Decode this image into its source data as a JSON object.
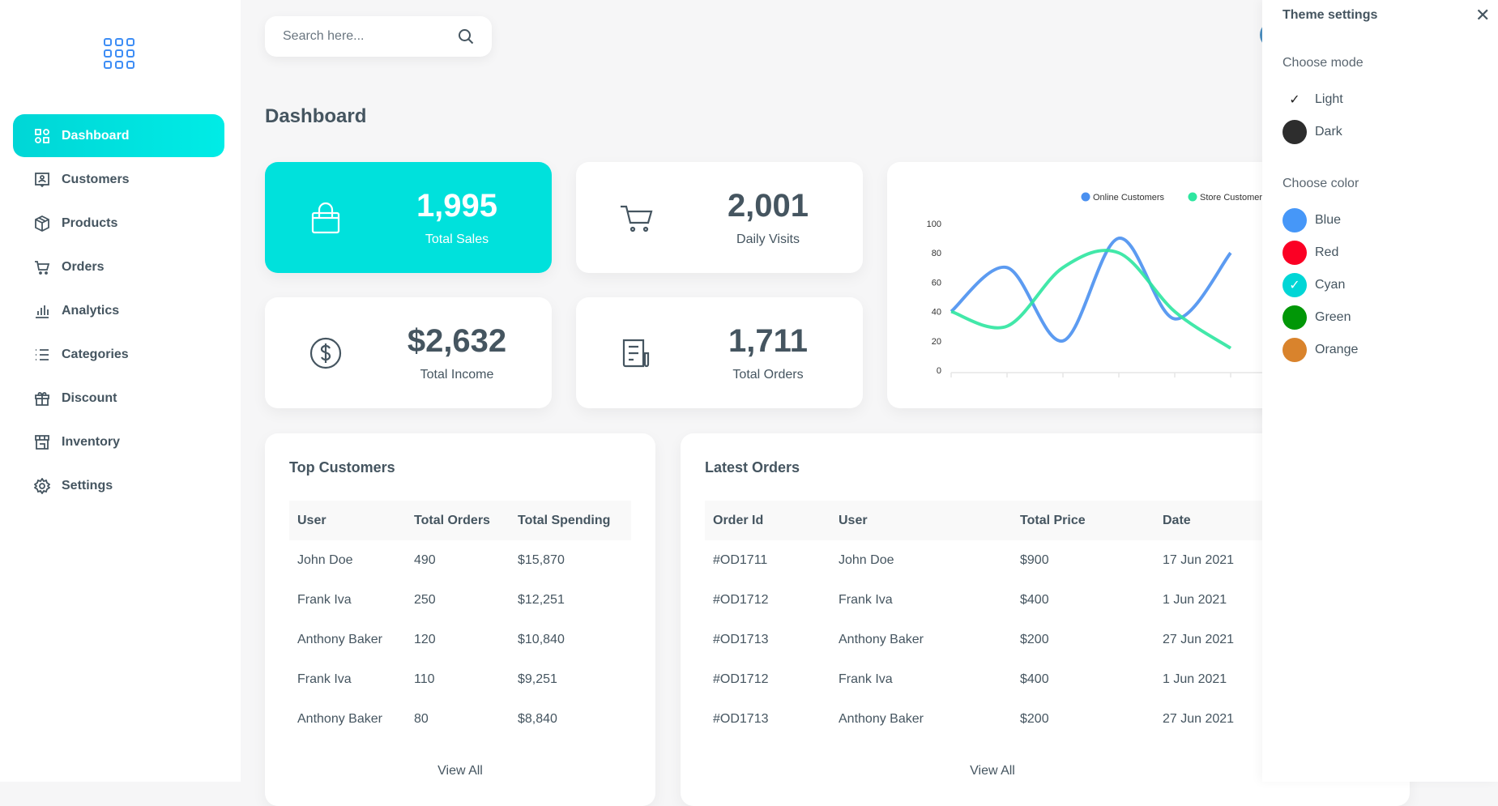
{
  "sidebar": {
    "logo_icon": "grid-icon",
    "items": [
      {
        "label": "Dashboard",
        "icon": "dashboard-icon",
        "active": true
      },
      {
        "label": "Customers",
        "icon": "customer-icon"
      },
      {
        "label": "Products",
        "icon": "package-icon"
      },
      {
        "label": "Orders",
        "icon": "cart-icon"
      },
      {
        "label": "Analytics",
        "icon": "bar-chart-icon"
      },
      {
        "label": "Categories",
        "icon": "list-icon"
      },
      {
        "label": "Discount",
        "icon": "gift-icon"
      },
      {
        "label": "Inventory",
        "icon": "store-icon"
      },
      {
        "label": "Settings",
        "icon": "gear-icon"
      }
    ]
  },
  "search": {
    "placeholder": "Search here..."
  },
  "page_title": "Dashboard",
  "stats": [
    {
      "value": "1,995",
      "label": "Total Sales",
      "icon": "shopping-bag-icon"
    },
    {
      "value": "2,001",
      "label": "Daily Visits",
      "icon": "cart-icon"
    },
    {
      "value": "$2,632",
      "label": "Total Income",
      "icon": "dollar-icon"
    },
    {
      "value": "1,711",
      "label": "Total Orders",
      "icon": "receipt-icon"
    }
  ],
  "chart_data": {
    "type": "line",
    "ylim": [
      0,
      100
    ],
    "yticks": [
      0,
      20,
      40,
      60,
      80,
      100
    ],
    "grid": false,
    "legend": "top",
    "series": [
      {
        "name": "Online Customers",
        "color": "#4a90f0",
        "values": [
          40,
          70,
          20,
          90,
          35,
          80
        ]
      },
      {
        "name": "Store Customers",
        "color": "#2ee6a0",
        "values": [
          40,
          30,
          70,
          80,
          40,
          15
        ]
      }
    ]
  },
  "top_customers": {
    "title": "Top Customers",
    "headers": [
      "User",
      "Total Orders",
      "Total Spending"
    ],
    "rows": [
      [
        "John Doe",
        "490",
        "$15,870"
      ],
      [
        "Frank Iva",
        "250",
        "$12,251"
      ],
      [
        "Anthony Baker",
        "120",
        "$10,840"
      ],
      [
        "Frank Iva",
        "110",
        "$9,251"
      ],
      [
        "Anthony Baker",
        "80",
        "$8,840"
      ]
    ],
    "view_all": "View All"
  },
  "latest_orders": {
    "title": "Latest Orders",
    "headers": [
      "Order Id",
      "User",
      "Total Price",
      "Date"
    ],
    "rows": [
      [
        "#OD1711",
        "John Doe",
        "$900",
        "17 Jun 2021"
      ],
      [
        "#OD1712",
        "Frank Iva",
        "$400",
        "1 Jun 2021"
      ],
      [
        "#OD1713",
        "Anthony Baker",
        "$200",
        "27 Jun 2021"
      ],
      [
        "#OD1712",
        "Frank Iva",
        "$400",
        "1 Jun 2021"
      ],
      [
        "#OD1713",
        "Anthony Baker",
        "$200",
        "27 Jun 2021"
      ]
    ],
    "view_all": "View All"
  },
  "theme": {
    "title": "Theme settings",
    "mode_label": "Choose mode",
    "modes": [
      {
        "label": "Light",
        "selected": true
      },
      {
        "label": "Dark",
        "color": "#2d2d2d"
      }
    ],
    "color_label": "Choose color",
    "colors": [
      {
        "label": "Blue",
        "color": "#4697f8"
      },
      {
        "label": "Red",
        "color": "#fb0024"
      },
      {
        "label": "Cyan",
        "color": "#00d6d6",
        "selected": true
      },
      {
        "label": "Green",
        "color": "#019707"
      },
      {
        "label": "Orange",
        "color": "#d9832c"
      }
    ]
  },
  "colors": {
    "accent": "#00e1dc",
    "text": "#455560"
  }
}
